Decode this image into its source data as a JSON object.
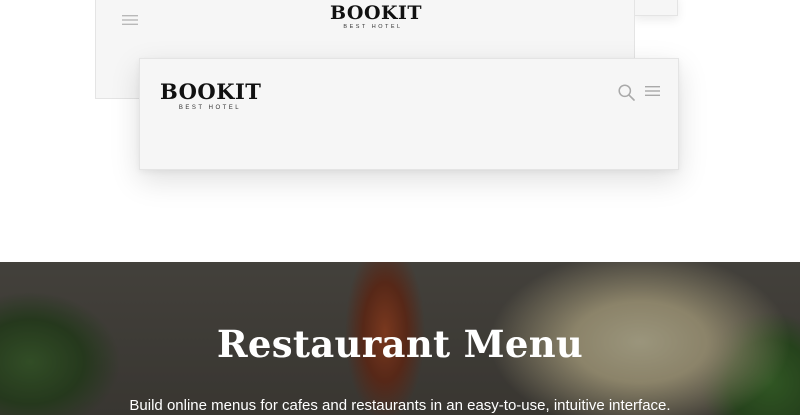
{
  "header_preview_back": {
    "logo_name": "BOOKIT",
    "logo_tagline": "BEST HOTEL",
    "menu_icon": "hamburger-icon"
  },
  "header_preview_front": {
    "logo_name": "BOOKIT",
    "logo_tagline": "BEST HOTEL",
    "search_icon": "search-icon",
    "menu_icon": "hamburger-icon"
  },
  "hero": {
    "title": "Restaurant Menu",
    "description": "Build online menus for cafes and restaurants in an easy-to-use, intuitive interface.",
    "background": "food-photo-with-dark-overlay"
  },
  "colors": {
    "card_background": "#f6f6f6",
    "card_border": "#e4e4e4",
    "logo_text": "#111111",
    "hero_overlay": "#2b2925",
    "hero_text": "#ffffff"
  }
}
